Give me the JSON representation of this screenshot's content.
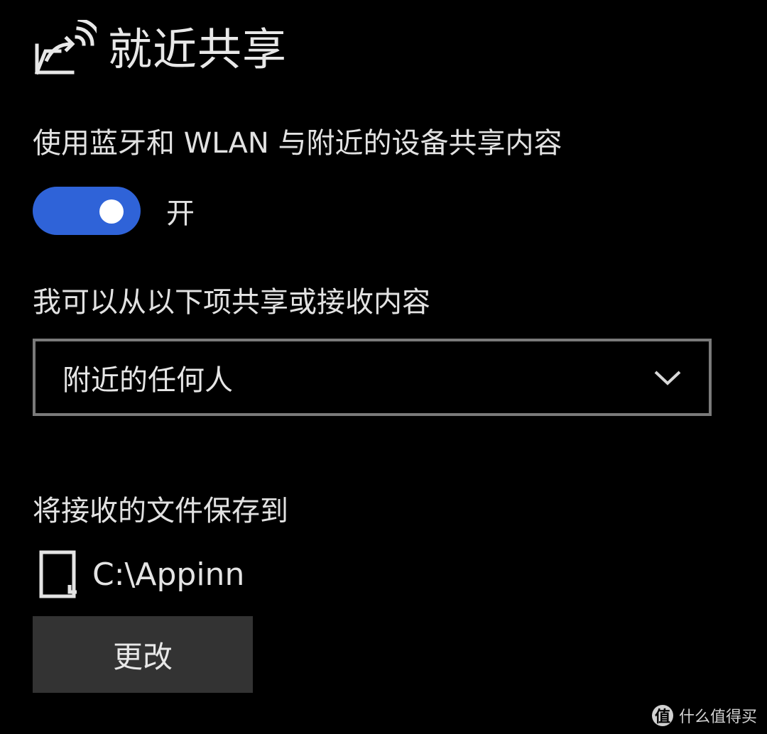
{
  "header": {
    "icon": "nearby-sharing-icon",
    "title": "就近共享"
  },
  "description": "使用蓝牙和 WLAN 与附近的设备共享内容",
  "toggle": {
    "state": "on",
    "label": "开",
    "accent_color": "#2f63d8"
  },
  "share_scope": {
    "label": "我可以从以下项共享或接收内容",
    "selected": "附近的任何人",
    "icon": "chevron-down-icon"
  },
  "save_location": {
    "label": "将接收的文件保存到",
    "path": "C:\\Appinn",
    "icon": "folder-icon",
    "change_button": "更改"
  },
  "watermark": {
    "badge": "值",
    "text": "什么值得买"
  }
}
